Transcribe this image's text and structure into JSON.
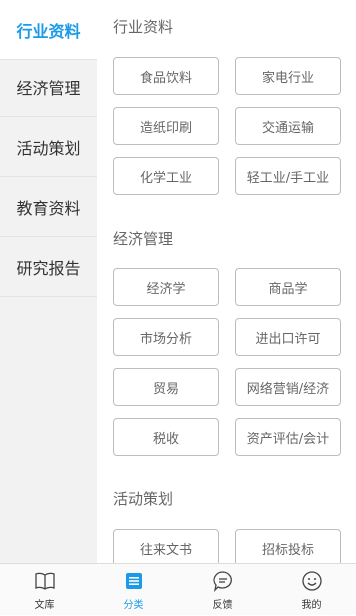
{
  "sidebar": {
    "items": [
      {
        "label": "行业资料"
      },
      {
        "label": "经济管理"
      },
      {
        "label": "活动策划"
      },
      {
        "label": "教育资料"
      },
      {
        "label": "研究报告"
      }
    ]
  },
  "sections": [
    {
      "title": "行业资料",
      "tags": [
        "食品饮料",
        "家电行业",
        "造纸印刷",
        "交通运输",
        "化学工业",
        "轻工业/手工业"
      ]
    },
    {
      "title": "经济管理",
      "tags": [
        "经济学",
        "商品学",
        "市场分析",
        "进出口许可",
        "贸易",
        "网络营销/经济",
        "税收",
        "资产评估/会计"
      ]
    },
    {
      "title": "活动策划",
      "tags": [
        "往来文书",
        "招标投标"
      ]
    }
  ],
  "tabbar": {
    "items": [
      {
        "label": "文库",
        "icon": "book-icon"
      },
      {
        "label": "分类",
        "icon": "category-icon"
      },
      {
        "label": "反馈",
        "icon": "chat-icon"
      },
      {
        "label": "我的",
        "icon": "smile-icon"
      }
    ]
  },
  "colors": {
    "accent": "#1a9bea",
    "text": "#333333",
    "muted": "#666666"
  }
}
